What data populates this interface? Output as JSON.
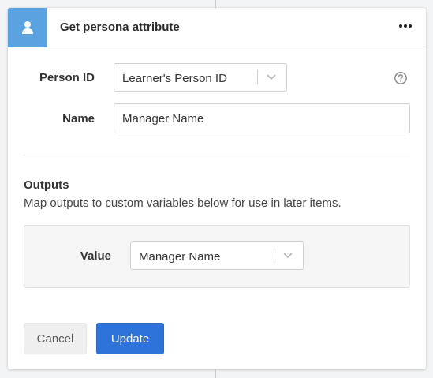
{
  "header": {
    "title": "Get persona attribute",
    "icon": "person-icon",
    "accent_color": "#5ba3e0"
  },
  "form": {
    "person_id": {
      "label": "Person ID",
      "selected_value": "Learner's Person ID"
    },
    "name": {
      "label": "Name",
      "value": "Manager Name"
    }
  },
  "outputs": {
    "title": "Outputs",
    "description": "Map outputs to custom variables below for use in later items.",
    "value": {
      "label": "Value",
      "selected_value": "Manager Name"
    }
  },
  "actions": {
    "cancel_label": "Cancel",
    "update_label": "Update",
    "primary_color": "#2e73d9"
  }
}
